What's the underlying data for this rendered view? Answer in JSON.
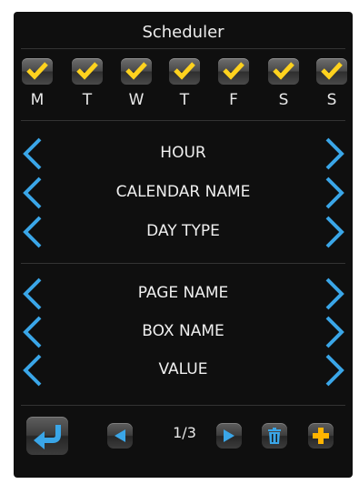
{
  "window": {
    "title": "Scheduler"
  },
  "days": [
    {
      "label": "M",
      "checked": true
    },
    {
      "label": "T",
      "checked": true
    },
    {
      "label": "W",
      "checked": true
    },
    {
      "label": "T",
      "checked": true
    },
    {
      "label": "F",
      "checked": true
    },
    {
      "label": "S",
      "checked": true
    },
    {
      "label": "S",
      "checked": true
    }
  ],
  "selectors": [
    {
      "label": "HOUR"
    },
    {
      "label": "CALENDAR NAME"
    },
    {
      "label": "DAY TYPE"
    },
    {
      "label": "PAGE NAME"
    },
    {
      "label": "BOX NAME"
    },
    {
      "label": "VALUE"
    }
  ],
  "footer": {
    "pager": "1/3"
  },
  "icons": {
    "checkbox": "check-icon",
    "prev_arrow": "chevron-left-icon",
    "next_arrow": "chevron-right-icon",
    "back": "back-arrow-icon",
    "page_prev": "triangle-left-icon",
    "page_next": "triangle-right-icon",
    "delete": "trash-icon",
    "add": "plus-icon"
  },
  "colors": {
    "background": "#0f0f0f",
    "accent_blue": "#3aa6e8",
    "check_yellow": "#ffd21e",
    "add_orange": "#ffb400",
    "text": "#ececec"
  }
}
